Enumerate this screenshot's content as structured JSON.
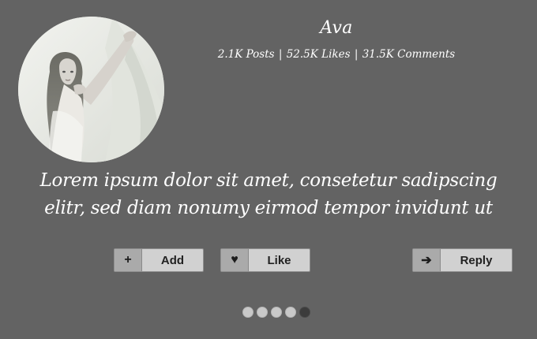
{
  "profile": {
    "name": "Ava",
    "stats": {
      "posts": "2.1K Posts",
      "likes": "52.5K Likes",
      "comments": "31.5K Comments",
      "separator": "|"
    }
  },
  "quote": {
    "line1": "Lorem ipsum dolor sit amet, consetetur sadipscing",
    "line2": "elitr, sed diam nonumy eirmod tempor invidunt ut"
  },
  "actions": {
    "add": {
      "label": "Add",
      "icon": "plus-icon",
      "glyph": "+"
    },
    "like": {
      "label": "Like",
      "icon": "heart-icon",
      "glyph": "♥"
    },
    "reply": {
      "label": "Reply",
      "icon": "arrow-right-icon",
      "glyph": "➔"
    }
  },
  "pagination": {
    "total": 5,
    "active_index": 4
  },
  "colors": {
    "background": "#636363",
    "text": "#ffffff",
    "button_face": "#d1d1d1",
    "button_icon_bg": "#aaaaaa",
    "dot_inactive": "#c9c9c9",
    "dot_active": "#3c3c3c"
  }
}
